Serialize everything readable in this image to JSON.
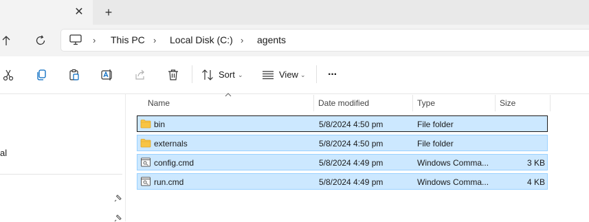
{
  "tabbar": {
    "close_label": "✕",
    "new_tab_label": "+"
  },
  "breadcrumb": {
    "items": [
      "This PC",
      "Local Disk (C:)",
      "agents"
    ],
    "separator": "›"
  },
  "toolbar": {
    "sort_label": "Sort",
    "view_label": "View",
    "more_label": "···",
    "caret": "⌄"
  },
  "sidebar": {
    "partial_label": "al"
  },
  "file_list": {
    "columns": {
      "name": "Name",
      "date": "Date modified",
      "type": "Type",
      "size": "Size"
    },
    "rows": [
      {
        "icon": "folder-icon",
        "name": "bin",
        "date": "5/8/2024 4:50 pm",
        "type": "File folder",
        "size": ""
      },
      {
        "icon": "folder-icon",
        "name": "externals",
        "date": "5/8/2024 4:50 pm",
        "type": "File folder",
        "size": ""
      },
      {
        "icon": "script-file-icon",
        "name": "config.cmd",
        "date": "5/8/2024 4:49 pm",
        "type": "Windows Comma...",
        "size": "3 KB"
      },
      {
        "icon": "script-file-icon",
        "name": "run.cmd",
        "date": "5/8/2024 4:49 pm",
        "type": "Windows Comma...",
        "size": "4 KB"
      }
    ]
  },
  "colors": {
    "selection": "#cce8ff",
    "selection_border": "#99d1ff",
    "accent": "#0067c0",
    "folder": "#f8c443"
  }
}
